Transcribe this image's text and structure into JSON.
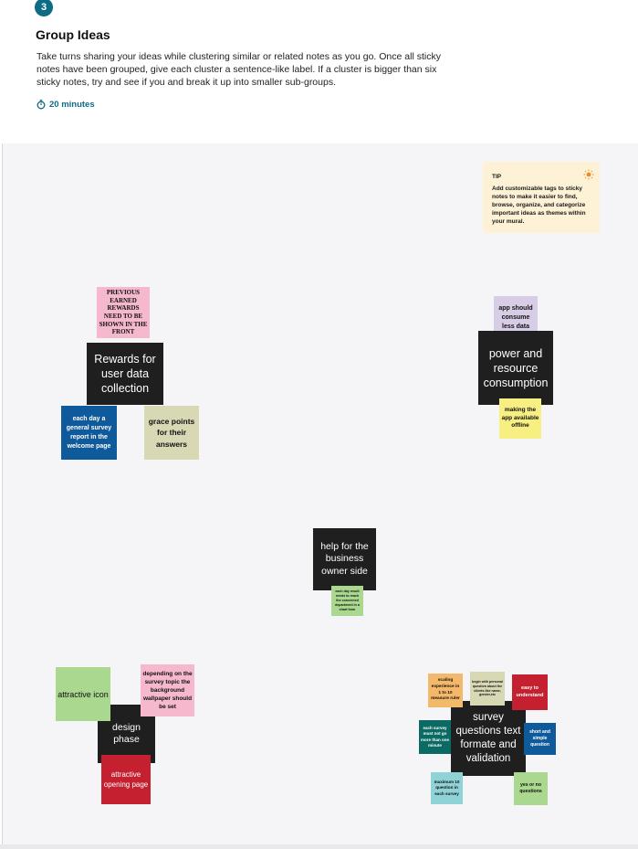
{
  "header": {
    "step": "3",
    "title": "Group Ideas",
    "description": "Take turns sharing your ideas while clustering similar or related notes as you go. Once all sticky notes have been grouped, give each cluster a sentence-like label. If a cluster is bigger than six sticky notes, try and see if you and break it up into smaller sub-groups.",
    "timer": "20 minutes"
  },
  "tip": {
    "title": "TIP",
    "text": "Add customizable tags to sticky notes to make it easier to find, browse, organize, and categorize important ideas as themes within your mural."
  },
  "clusters": {
    "rewards": {
      "label": "Rewards for user data collection",
      "note_pink": "PREVIOUS EARNED REWARDS NEED TO BE SHOWN IN THE FRONT",
      "note_blue": "each day a general survey report in the welcome page",
      "note_beige": "grace points for their answers"
    },
    "power": {
      "label": "power and resource consumption",
      "note_lilac": "app should consume less data",
      "note_yellow": "making the app available offline"
    },
    "business": {
      "label": "help for the business owner side",
      "note_green": "each day result needs to reach the concerned department in a chart form"
    },
    "design": {
      "label": "design phase",
      "note_green": "attractive icon",
      "note_pink": "depending on the survey topic the background wallpaper should be set",
      "note_red": "attractive opening page"
    },
    "survey": {
      "label": "survey questions text formate and validation",
      "note_orange": "scaling experience in 1 to 10 measure ruler",
      "note_beige": "begin with personal question about the clients like name, gender,etc",
      "note_red": "easy to understand",
      "note_teal": "each survey must not go more than one minute",
      "note_blue": "short and simple question",
      "note_cyan": "maximum 10 question in each survey",
      "note_green": "yes or no questions"
    }
  },
  "colors": {
    "accent": "#0e6b86",
    "card": "#1f1f1f",
    "pink": "#f5b8cc",
    "blue": "#0f5a9a",
    "beige": "#d9d8b4",
    "lilac": "#d8cde6",
    "yellow": "#f7ef82",
    "green": "#a9d88e",
    "red": "#c4202f",
    "orange": "#f3b86a",
    "teal": "#0b6b64",
    "cyan": "#8fd3d6",
    "tip_bg": "#fdf1d6"
  },
  "icons": {
    "timer": "stopwatch-icon",
    "tip": "lightbulb-icon"
  }
}
